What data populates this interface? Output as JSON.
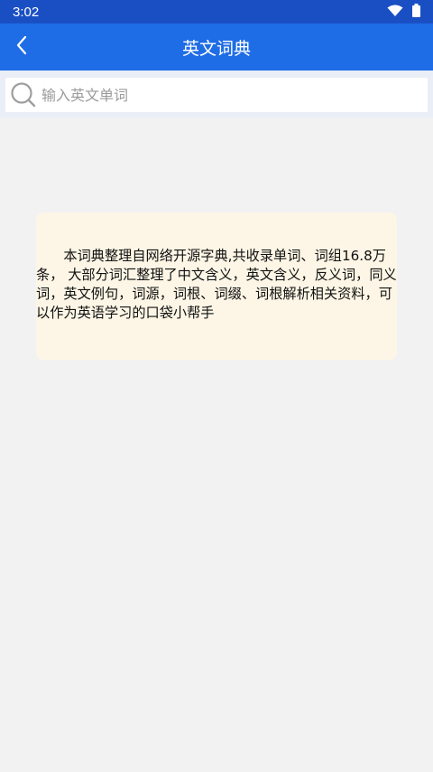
{
  "status_bar": {
    "time": "3:02",
    "icons": [
      "wifi-icon",
      "battery-icon"
    ]
  },
  "app_bar": {
    "back_icon": "chevron-left-icon",
    "title": "英文词典"
  },
  "search": {
    "icon": "search-icon",
    "placeholder": "输入英文单词",
    "value": ""
  },
  "info": {
    "text": "本词典整理自网络开源字典,共收录单词、词组16.8万条， 大部分词汇整理了中文含义，英文含义，反义词，同义词，英文例句，词源，词根、词缀、词根解析相关资料，可以作为英语学习的口袋小帮手"
  },
  "colors": {
    "status_bar": "#1a4fc4",
    "app_bar": "#1f6de6",
    "background": "#f2f2f2",
    "card": "#fdf6e6"
  }
}
